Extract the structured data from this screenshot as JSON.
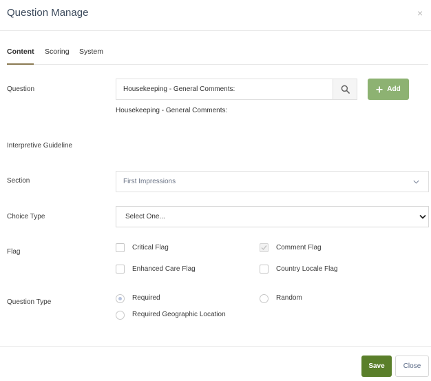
{
  "dialog": {
    "title": "Question Manage",
    "close_glyph": "×"
  },
  "tabs": [
    {
      "label": "Content",
      "active": true
    },
    {
      "label": "Scoring",
      "active": false
    },
    {
      "label": "System",
      "active": false
    }
  ],
  "question": {
    "label": "Question",
    "value": "Housekeeping - General Comments:",
    "preview": "Housekeeping - General Comments:",
    "add_label": "Add"
  },
  "guideline": {
    "label": "Interpretive Guideline"
  },
  "section": {
    "label": "Section",
    "value": "First Impressions"
  },
  "choice_type": {
    "label": "Choice Type",
    "value": "Select One..."
  },
  "flag": {
    "label": "Flag",
    "options": [
      {
        "label": "Critical Flag",
        "checked": false
      },
      {
        "label": "Comment Flag",
        "checked": true
      },
      {
        "label": "Enhanced Care Flag",
        "checked": false
      },
      {
        "label": "Country Locale Flag",
        "checked": false
      }
    ]
  },
  "question_type": {
    "label": "Question Type",
    "options": [
      {
        "label": "Required",
        "selected": true
      },
      {
        "label": "Random",
        "selected": false
      },
      {
        "label": "Required Geographic Location",
        "selected": false
      }
    ]
  },
  "footer": {
    "save_label": "Save",
    "close_label": "Close"
  },
  "colors": {
    "add": "#8db272",
    "save": "#5a7f2a",
    "tab_underline": "#8a7a52"
  }
}
